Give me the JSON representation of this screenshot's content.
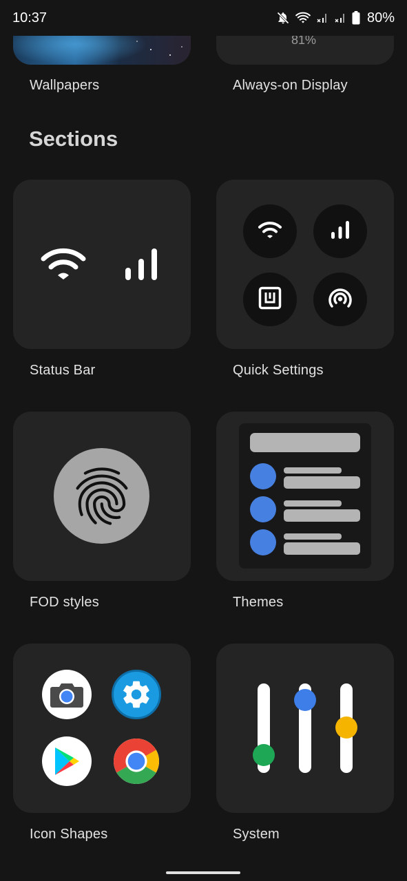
{
  "status": {
    "time": "10:37",
    "battery": "80%"
  },
  "top_cards": {
    "wallpapers_label": "Wallpapers",
    "aod_label": "Always-on Display",
    "aod_value": "81%"
  },
  "sections_title": "Sections",
  "cards": {
    "status_bar": "Status Bar",
    "quick_settings": "Quick Settings",
    "fod_styles": "FOD styles",
    "themes": "Themes",
    "icon_shapes": "Icon Shapes",
    "system": "System"
  },
  "colors": {
    "background": "#151515",
    "card": "#242424",
    "theme_accent": "#4680e0",
    "slider_green": "#1ea855",
    "slider_blue": "#3d7ee8",
    "slider_yellow": "#f4b400"
  },
  "system_sliders": [
    {
      "color_name": "green",
      "level": 0.2
    },
    {
      "color_name": "blue",
      "level": 0.85
    },
    {
      "color_name": "yellow",
      "level": 0.5
    }
  ]
}
